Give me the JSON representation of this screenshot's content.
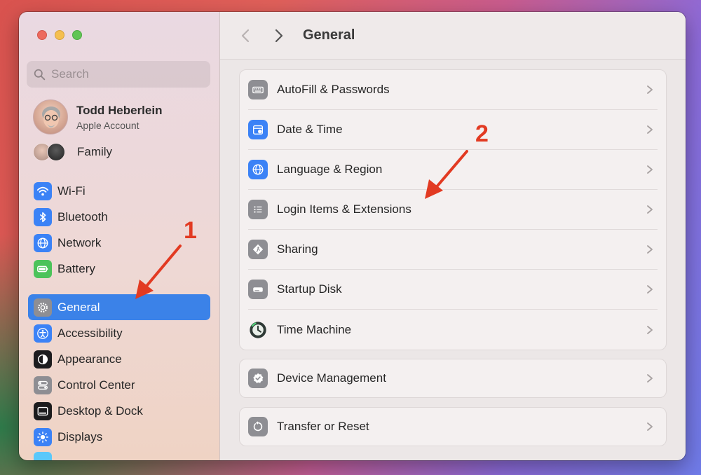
{
  "search": {
    "placeholder": "Search"
  },
  "account": {
    "name": "Todd Heberlein",
    "subtitle": "Apple Account"
  },
  "family": {
    "label": "Family"
  },
  "sidebar": {
    "network_items": [
      {
        "label": "Wi-Fi",
        "icon": "wifi-icon",
        "color": "#3b82f6"
      },
      {
        "label": "Bluetooth",
        "icon": "bluetooth-icon",
        "color": "#3b82f6"
      },
      {
        "label": "Network",
        "icon": "globe-icon",
        "color": "#3b82f6"
      },
      {
        "label": "Battery",
        "icon": "battery-icon",
        "color": "#4cc35a"
      }
    ],
    "system_items": [
      {
        "label": "General",
        "icon": "gear-icon",
        "color": "#8e8e93",
        "active": true
      },
      {
        "label": "Accessibility",
        "icon": "accessibility-icon",
        "color": "#3b82f6"
      },
      {
        "label": "Appearance",
        "icon": "appearance-icon",
        "color": "#1c1c1e"
      },
      {
        "label": "Control Center",
        "icon": "control-center-icon",
        "color": "#8e8e93"
      },
      {
        "label": "Desktop & Dock",
        "icon": "dock-icon",
        "color": "#1c1c1e"
      },
      {
        "label": "Displays",
        "icon": "sun-icon",
        "color": "#3b82f6"
      }
    ]
  },
  "header": {
    "title": "General"
  },
  "settings": {
    "group1": [
      {
        "label": "AutoFill & Passwords",
        "icon": "keyboard-icon",
        "color": "#8e8e93"
      },
      {
        "label": "Date & Time",
        "icon": "calendar-icon",
        "color": "#3b82f6"
      },
      {
        "label": "Language & Region",
        "icon": "globe-icon",
        "color": "#3b82f6"
      },
      {
        "label": "Login Items & Extensions",
        "icon": "list-icon",
        "color": "#8e8e93"
      },
      {
        "label": "Sharing",
        "icon": "sharing-icon",
        "color": "#8e8e93"
      },
      {
        "label": "Startup Disk",
        "icon": "disk-icon",
        "color": "#8e8e93"
      },
      {
        "label": "Time Machine",
        "icon": "time-machine-icon",
        "color": "#2f3a36"
      }
    ],
    "group2": [
      {
        "label": "Device Management",
        "icon": "badge-check-icon",
        "color": "#8e8e93"
      }
    ],
    "group3": [
      {
        "label": "Transfer or Reset",
        "icon": "reset-icon",
        "color": "#8e8e93"
      }
    ]
  },
  "annotations": {
    "step1": "1",
    "step2": "2",
    "color": "#e23a22"
  }
}
